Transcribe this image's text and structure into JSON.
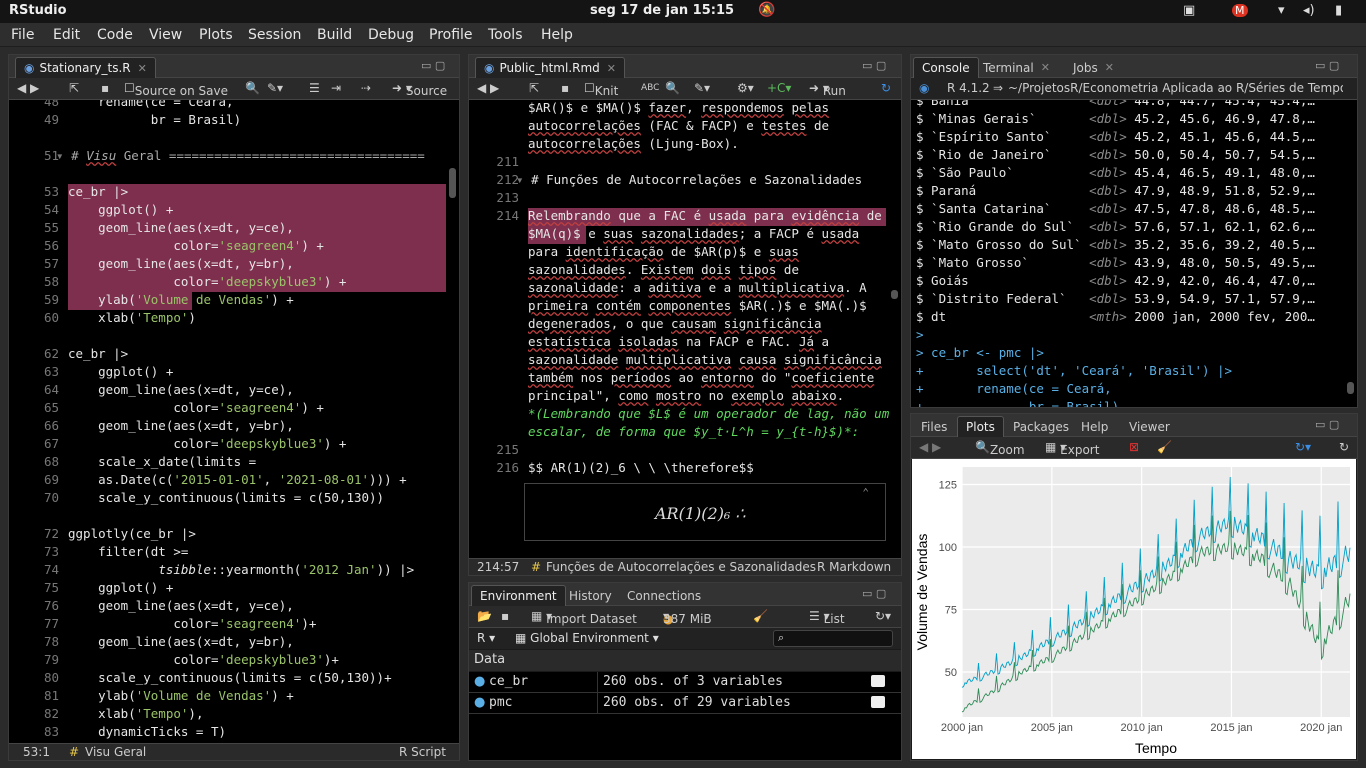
{
  "topbar": {
    "app": "RStudio",
    "clock": "seg 17 de jan  15:15"
  },
  "menu": [
    "File",
    "Edit",
    "Code",
    "View",
    "Plots",
    "Session",
    "Build",
    "Debug",
    "Profile",
    "Tools",
    "Help"
  ],
  "left_pane": {
    "tab": "Stationary_ts.R",
    "source_on_save": "Source on Save",
    "source_btn": "Source",
    "status": {
      "pos": "53:1",
      "section": "Visu Geral",
      "type": "R Script"
    }
  },
  "mid_pane": {
    "tab": "Public_html.Rmd",
    "knit": "Knit",
    "run": "Run",
    "status": {
      "pos": "214:57",
      "section": "Funções de Autocorrelações e Sazonalidades",
      "type": "R Markdown"
    },
    "rendered_math": "AR(1)(2)₆  ∴"
  },
  "env_pane": {
    "tabs": [
      "Environment",
      "History",
      "Connections"
    ],
    "import": "Import Dataset",
    "mem": "387 MiB",
    "list": "List",
    "lang": "R",
    "scope": "Global Environment",
    "section": "Data",
    "rows": [
      {
        "name": "ce_br",
        "desc": "260 obs. of 3 variables"
      },
      {
        "name": "pmc",
        "desc": "260 obs. of 29 variables"
      }
    ]
  },
  "console_pane": {
    "tabs": [
      "Console",
      "Terminal",
      "Jobs"
    ],
    "version": "R 4.1.2",
    "path": "~/ProjetosR/Econometria Aplicada ao R/Séries de Tempo/Séries"
  },
  "plots_pane": {
    "tabs": [
      "Files",
      "Plots",
      "Packages",
      "Help",
      "Viewer"
    ],
    "zoom": "Zoom",
    "export": "Export"
  },
  "chart_data": {
    "type": "line",
    "xlabel": "Tempo",
    "ylabel": "Volume de Vendas",
    "xticks": [
      "2000 jan",
      "2005 jan",
      "2010 jan",
      "2015 jan",
      "2020 jan"
    ],
    "yticks": [
      "50",
      "75",
      "100",
      "125"
    ],
    "xlim": [
      2000,
      2021.6
    ],
    "ylim": [
      32,
      132
    ],
    "series": [
      {
        "color": "#2e8b57",
        "values": [
          35.2,
          42,
          50,
          56,
          64,
          72,
          80,
          88,
          98,
          100,
          96,
          85,
          60,
          80
        ]
      },
      {
        "color": "#00a0c8",
        "values": [
          45.4,
          50,
          56,
          63,
          70,
          78,
          86,
          94,
          105,
          110,
          104,
          95,
          90,
          98
        ]
      }
    ]
  }
}
